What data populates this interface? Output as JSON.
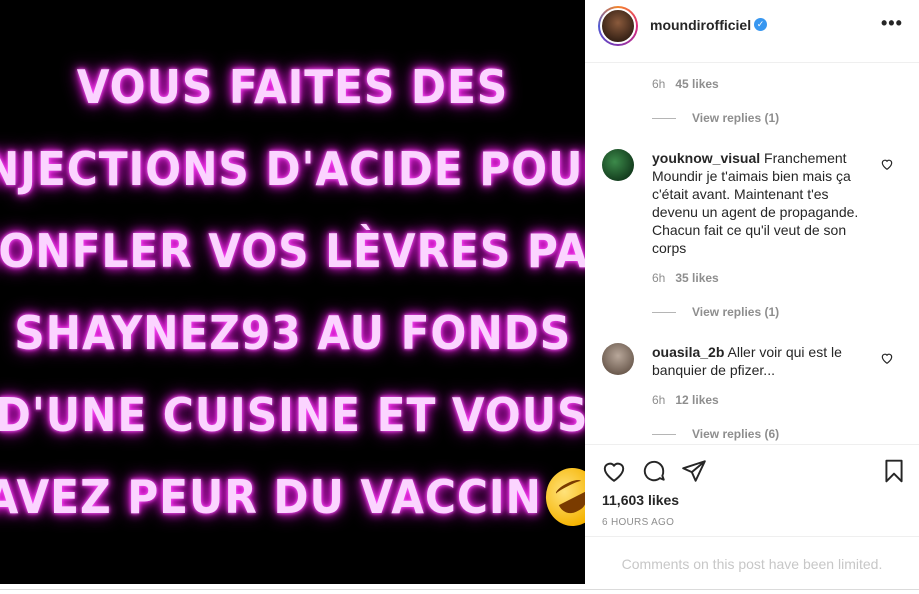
{
  "post": {
    "image_lines": [
      "VOUS FAITES DES",
      "INJECTIONS D'ACIDE POUR",
      "GONFLER VOS LÈVRES PAR",
      "SHAYNEZ93 AU FONDS",
      "D'UNE CUISINE ET VOUS",
      "AVEZ PEUR DU VACCIN"
    ],
    "image_emoji": "rolling-on-floor-laughing"
  },
  "header": {
    "username": "moundirofficiel",
    "verified_icon": "verified-check-icon",
    "more_icon": "more-horizontal-icon",
    "more_label": "•••"
  },
  "comments": [
    {
      "time": "6h",
      "likes": "45 likes",
      "replies": "View replies (1)"
    },
    {
      "user": "youknow_visual",
      "text": "Franchement Moundir je t'aimais bien mais ça c'était avant. Maintenant t'es devenu un agent de propagande. Chacun fait ce qu'il veut de son corps",
      "time": "6h",
      "likes": "35 likes",
      "replies": "View replies (1)"
    },
    {
      "user": "ouasila_2b",
      "text": "Aller voir qui est le banquier de pfizer...",
      "time": "6h",
      "likes": "12 likes",
      "replies": "View replies (6)"
    }
  ],
  "actions": {
    "icons": [
      "heart-icon",
      "comment-icon",
      "share-icon",
      "bookmark-icon"
    ],
    "likes_count": "11,603 likes",
    "timestamp": "6 HOURS AGO"
  },
  "footer": {
    "comments_limited": "Comments on this post have been limited."
  },
  "colors": {
    "neon": "#ff2bf2",
    "verified": "#3897f0",
    "muted": "#8e8e8e"
  }
}
